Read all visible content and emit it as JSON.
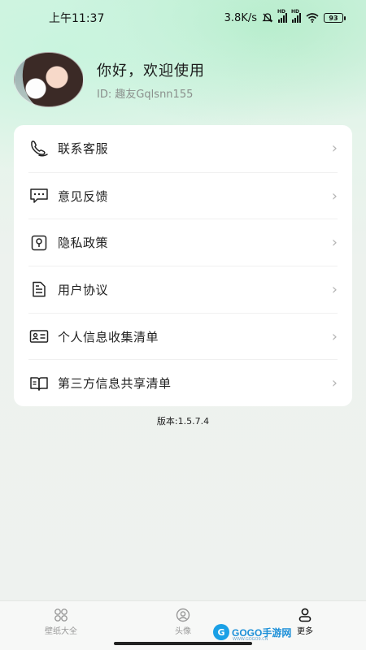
{
  "status_bar": {
    "time": "上午11:37",
    "net_speed": "3.8K/s",
    "battery": "93"
  },
  "profile": {
    "greeting": "你好，欢迎使用",
    "user_id": "ID: 趣友Gqlsnn155"
  },
  "menu": {
    "items": [
      {
        "label": "联系客服",
        "icon": "customer-service-icon"
      },
      {
        "label": "意见反馈",
        "icon": "feedback-icon"
      },
      {
        "label": "隐私政策",
        "icon": "privacy-lock-icon"
      },
      {
        "label": "用户协议",
        "icon": "document-icon"
      },
      {
        "label": "个人信息收集清单",
        "icon": "id-card-icon"
      },
      {
        "label": "第三方信息共享清单",
        "icon": "open-book-icon"
      }
    ]
  },
  "version": "版本:1.5.7.4",
  "tabbar": {
    "tabs": [
      {
        "label": "壁纸大全",
        "icon": "grid-icon",
        "active": false
      },
      {
        "label": "头像",
        "icon": "avatar-icon",
        "active": false
      },
      {
        "label": "更多",
        "icon": "person-icon",
        "active": true
      }
    ]
  },
  "watermark": {
    "text": "GOGO手游网",
    "sub": "WWW.GOGO9.CN"
  }
}
